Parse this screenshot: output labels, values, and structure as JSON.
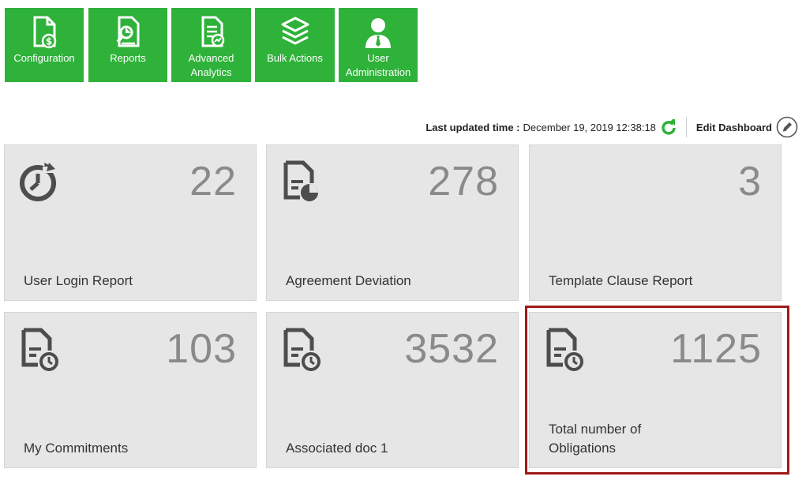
{
  "nav": {
    "configuration": "Configuration",
    "reports": "Reports",
    "advanced_analytics": "Advanced\nAnalytics",
    "bulk_actions": "Bulk Actions",
    "user_administration": "User\nAdministration"
  },
  "status": {
    "last_updated_label": "Last updated time :",
    "last_updated_value": "December 19, 2019 12:38:18",
    "edit_dashboard": "Edit Dashboard"
  },
  "tiles": [
    {
      "value": "22",
      "title": "User Login Report",
      "icon": "clock-arrow-icon"
    },
    {
      "value": "278",
      "title": "Agreement Deviation",
      "icon": "document-pie-icon"
    },
    {
      "value": "3",
      "title": "Template Clause Report",
      "icon": ""
    },
    {
      "value": "103",
      "title": "My Commitments",
      "icon": "document-clock-icon"
    },
    {
      "value": "3532",
      "title": "Associated doc 1",
      "icon": "document-clock-icon"
    },
    {
      "value": "1125",
      "title": "Total number of Obligations",
      "icon": "document-clock-icon"
    }
  ],
  "colors": {
    "nav_green": "#2fb23a",
    "tile_bg": "#e6e6e6",
    "highlight": "#a01a1a",
    "refresh_green": "#2fb23a"
  }
}
